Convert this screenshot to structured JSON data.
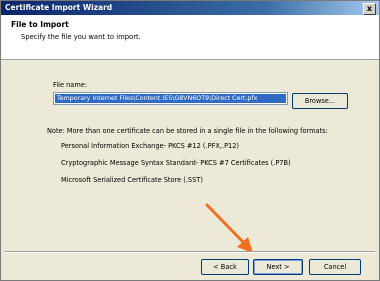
{
  "window": {
    "title": "Certificate Import Wizard",
    "close_glyph": "x"
  },
  "header": {
    "title": "File to Import",
    "subtitle": "Specify the file you want to import."
  },
  "form": {
    "file_label": "File name:",
    "file_value": "Temporary Internet Files\\Content.IE5\\G8VN6OT9\\Direct Cert.pfx",
    "browse_label": "Browse..."
  },
  "note": {
    "text": "Note:  More than one certificate can be stored in a single file in the following formats:",
    "formats": [
      "Personal Information Exchange- PKCS #12 (.PFX,.P12)",
      "Cryptographic Message Syntax Standard- PKCS #7 Certificates (.P7B)",
      "Microsoft Serialized Certificate Store (.SST)"
    ]
  },
  "footer": {
    "back_label": "< Back",
    "next_label": "Next >",
    "cancel_label": "Cancel"
  },
  "annotation": {
    "arrow_color": "#f07020"
  }
}
